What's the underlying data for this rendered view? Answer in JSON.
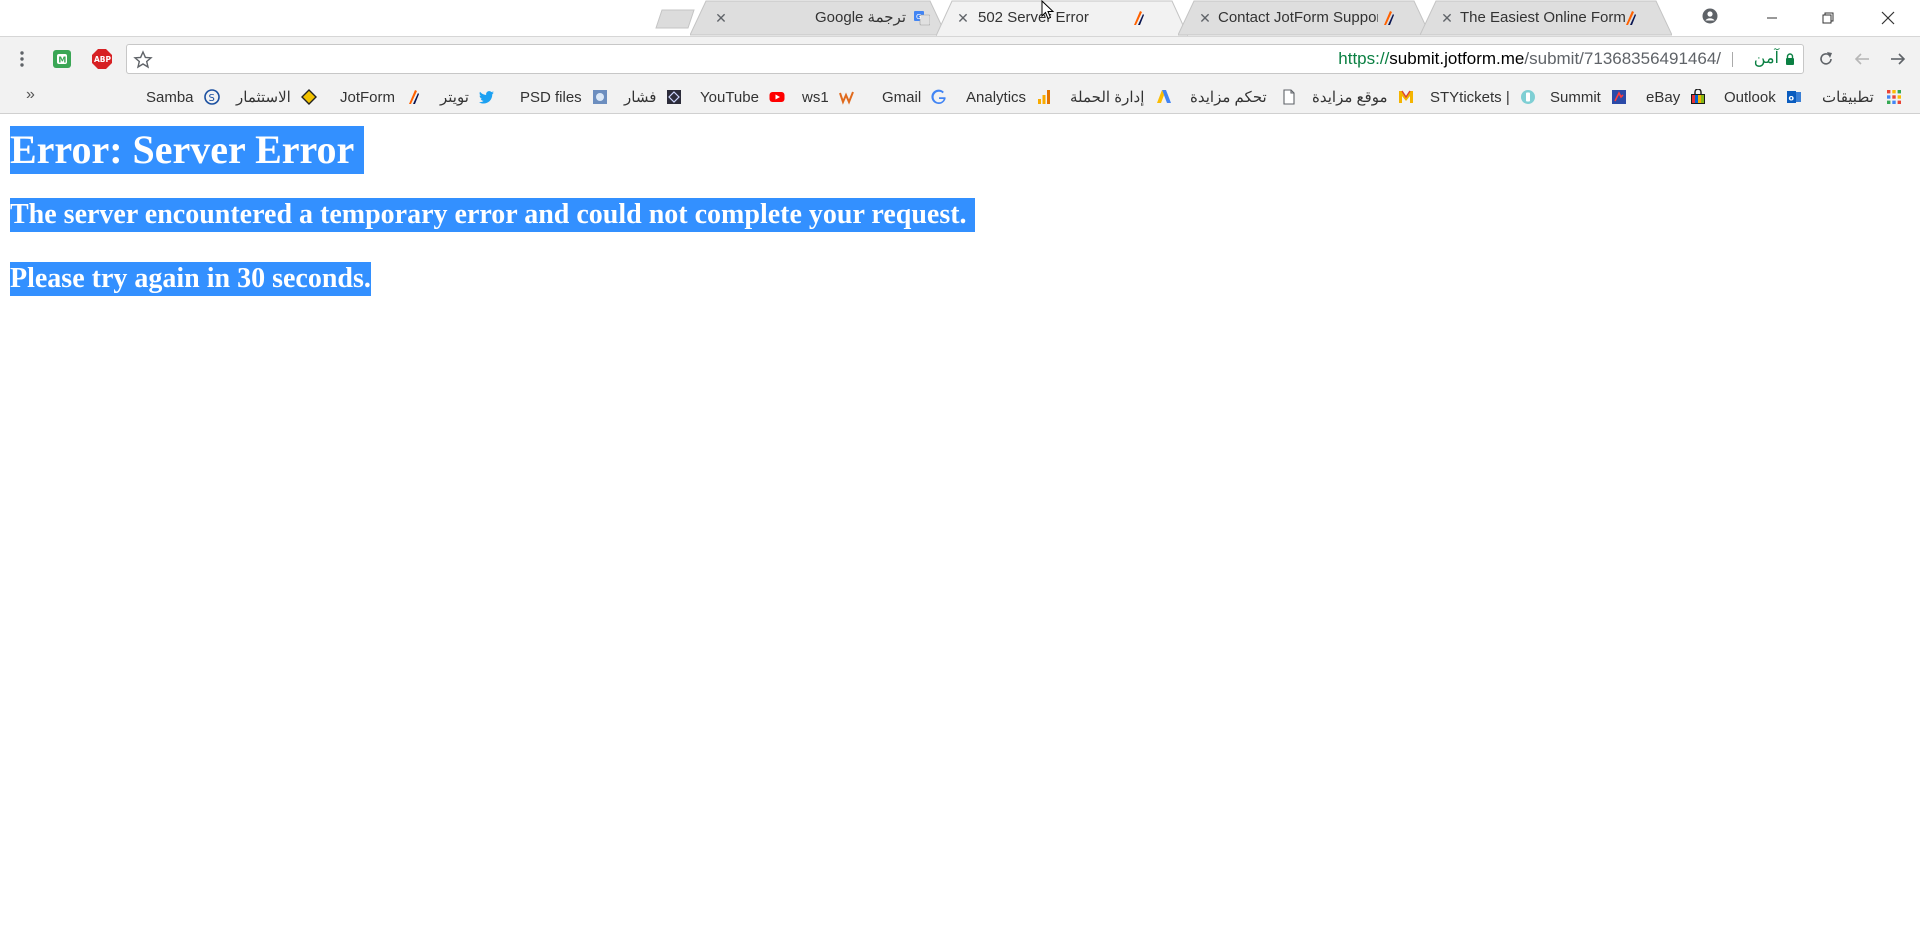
{
  "browser": {
    "tabs": [
      {
        "title": "The Easiest Online Form",
        "favicon": "jotform-icon",
        "active": false
      },
      {
        "title": "Contact JotForm Support",
        "favicon": "jotform-icon",
        "active": false
      },
      {
        "title": "502 Server Error",
        "favicon": "jotform-icon",
        "active": true
      },
      {
        "title": "ترجمة Google",
        "favicon": "google-translate-icon",
        "active": false
      }
    ],
    "omnibox": {
      "scheme": "https://",
      "host": "submit.jotform.me",
      "path": "/submit/71368356491464/",
      "security_label": "آمن"
    },
    "bookmarks": [
      {
        "label": "تطبيقات",
        "icon": "apps-grid-icon"
      },
      {
        "label": "Outlook",
        "icon": "outlook-icon"
      },
      {
        "label": "eBay",
        "icon": "ebay-icon"
      },
      {
        "label": "Summit",
        "icon": "summit-icon"
      },
      {
        "label": "STYtickets |",
        "icon": "stytickets-icon"
      },
      {
        "label": "موقع مزايدة",
        "icon": "m-icon"
      },
      {
        "label": "تحكم مزايدة",
        "icon": "page-icon"
      },
      {
        "label": "إدارة الحملة",
        "icon": "adwords-icon"
      },
      {
        "label": "Analytics",
        "icon": "analytics-icon"
      },
      {
        "label": "Gmail",
        "icon": "google-icon"
      },
      {
        "label": "ws1",
        "icon": "ws1-icon"
      },
      {
        "label": "YouTube",
        "icon": "youtube-icon"
      },
      {
        "label": "فشار",
        "icon": "fashar-icon"
      },
      {
        "label": "PSD files",
        "icon": "psd-icon"
      },
      {
        "label": "تويتر",
        "icon": "twitter-icon"
      },
      {
        "label": "JotForm",
        "icon": "jotform-icon"
      },
      {
        "label": "الاستثمار",
        "icon": "diamond-icon"
      },
      {
        "label": "Samba",
        "icon": "samba-icon"
      }
    ],
    "overflow_label": "»",
    "colors": {
      "selection": "#3390ff",
      "secure": "#0b8043",
      "chrome_bg": "#f2f2f2"
    }
  },
  "page": {
    "heading": "Error: Server Error",
    "message": "The server encountered a temporary error and could not complete your request.",
    "retry": "Please try again in 30 seconds."
  }
}
